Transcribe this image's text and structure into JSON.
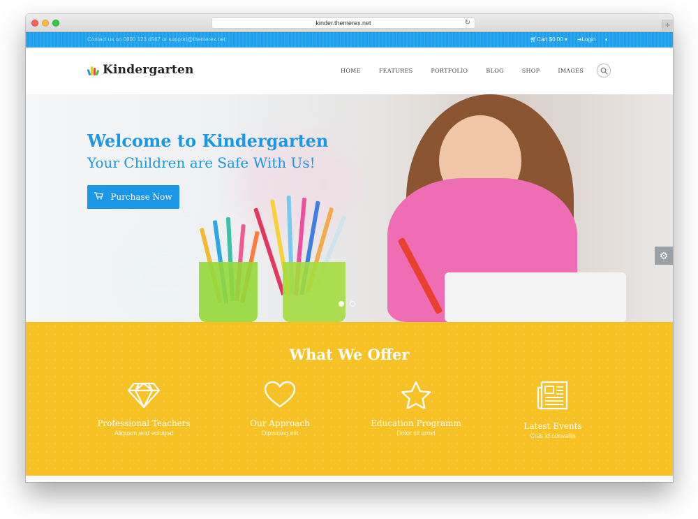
{
  "browser": {
    "url": "kinder.themerex.net",
    "new_tab": "+"
  },
  "topbar": {
    "contact": "Contact us on 0800 123 4567 or support@themerex.net",
    "cart": "Cart $0.00",
    "login": "Login"
  },
  "header": {
    "logo": "Kindergarten",
    "nav": [
      "HOME",
      "FEATURES",
      "PORTFOLIO",
      "BLOG",
      "SHOP",
      "IMAGES"
    ]
  },
  "hero": {
    "title": "Welcome to Kindergarten",
    "subtitle": "Your Children are Safe With Us!",
    "button": "Purchase Now"
  },
  "offer": {
    "title": "What We Offer",
    "features": [
      {
        "icon": "diamond-icon",
        "title": "Professional Teachers",
        "subtitle": "Aliquam erat volutpat"
      },
      {
        "icon": "heart-icon",
        "title": "Our Approach",
        "subtitle": "Dipisicing elit"
      },
      {
        "icon": "star-icon",
        "title": "Education Programm",
        "subtitle": "Dolor sit amet"
      },
      {
        "icon": "newspaper-icon",
        "title": "Latest Events",
        "subtitle": "Cras id convallis"
      }
    ]
  },
  "colors": {
    "accent": "#1c97e6",
    "offer_bg": "#f6c226",
    "topbar": "#1fa0ec"
  }
}
